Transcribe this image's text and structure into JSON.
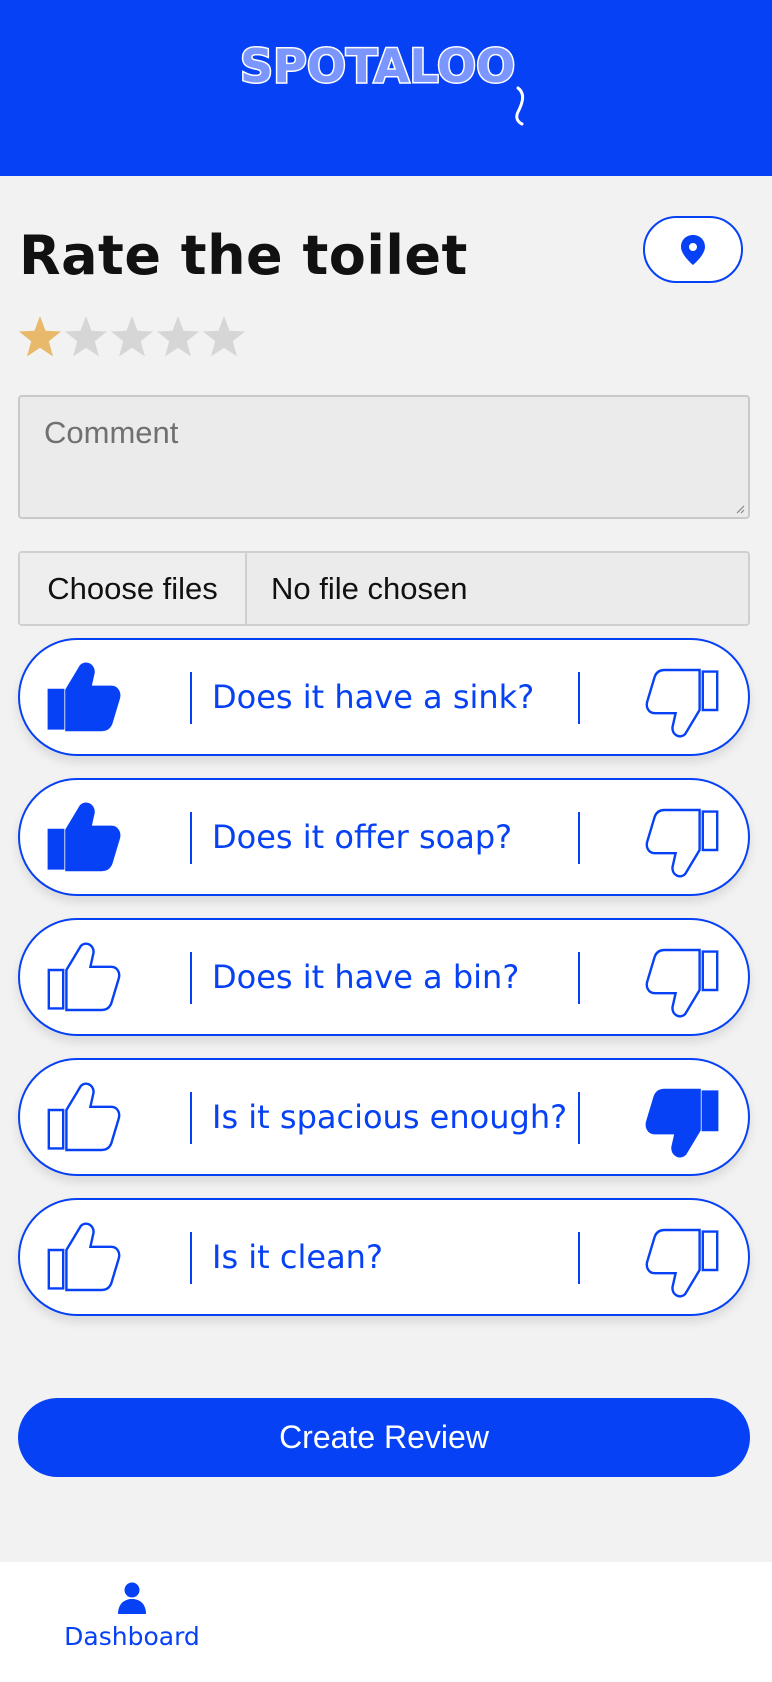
{
  "header": {
    "logo_text": "SPOTALOO"
  },
  "page": {
    "title": "Rate the toilet"
  },
  "rating": {
    "value": 1,
    "max": 5
  },
  "comment": {
    "placeholder": "Comment",
    "value": ""
  },
  "file_input": {
    "button_label": "Choose files",
    "status": "No file chosen"
  },
  "questions": [
    {
      "label": "Does it have a sink?",
      "answer": "yes"
    },
    {
      "label": "Does it offer soap?",
      "answer": "yes"
    },
    {
      "label": "Does it have a bin?",
      "answer": "none"
    },
    {
      "label": "Is it spacious enough?",
      "answer": "no"
    },
    {
      "label": "Is it clean?",
      "answer": "none"
    }
  ],
  "actions": {
    "create_label": "Create Review"
  },
  "nav": {
    "items": [
      {
        "label": "Dashboard",
        "icon": "user-icon",
        "active": true
      }
    ]
  },
  "colors": {
    "primary": "#0741f5",
    "star_active": "#e8b96a",
    "star_inactive": "#d6d6d6",
    "background": "#f2f2f2"
  }
}
